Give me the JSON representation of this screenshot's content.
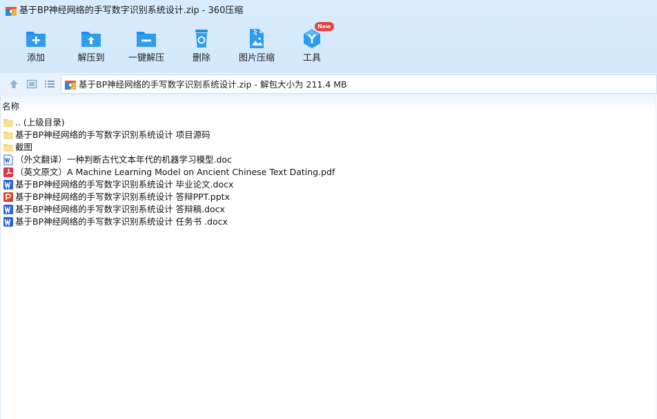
{
  "window": {
    "title": "基于BP神经网络的手写数字识别系统设计.zip - 360压缩",
    "app_icon": "archive-icon"
  },
  "toolbar": {
    "items": [
      {
        "label": "添加",
        "icon": "add-folder-icon"
      },
      {
        "label": "解压到",
        "icon": "extract-to-icon"
      },
      {
        "label": "一键解压",
        "icon": "one-click-extract-icon"
      },
      {
        "label": "删除",
        "icon": "recycle-bin-icon"
      },
      {
        "label": "图片压缩",
        "icon": "image-compress-icon"
      },
      {
        "label": "工具",
        "icon": "tools-icon",
        "badge": "New"
      }
    ]
  },
  "address": {
    "text": "基于BP神经网络的手写数字识别系统设计.zip - 解包大小为 211.4 MB"
  },
  "list": {
    "column_header": "名称",
    "rows": [
      {
        "name": ".. (上级目录)",
        "type": "folder"
      },
      {
        "name": "基于BP神经网络的手写数字识别系统设计 项目源码",
        "type": "folder"
      },
      {
        "name": "截图",
        "type": "folder"
      },
      {
        "name": "（外文翻译）一种判断古代文本年代的机器学习模型.doc",
        "type": "doc"
      },
      {
        "name": "（英文原文）A Machine Learning Model on Ancient Chinese Text Dating.pdf",
        "type": "pdf"
      },
      {
        "name": "基于BP神经网络的手写数字识别系统设计 毕业论文.docx",
        "type": "word"
      },
      {
        "name": "基于BP神经网络的手写数字识别系统设计 答辩PPT.pptx",
        "type": "ppt"
      },
      {
        "name": "基于BP神经网络的手写数字识别系统设计 答辩稿.docx",
        "type": "word"
      },
      {
        "name": "基于BP神经网络的手写数字识别系统设计 任务书 .docx",
        "type": "word"
      }
    ]
  },
  "colors": {
    "accent": "#1e8fe8",
    "folder": "#f6d06e",
    "word": "#2b63d9",
    "ppt": "#d9442a",
    "pdf": "#d7364c",
    "badge": "#f03a3a"
  }
}
